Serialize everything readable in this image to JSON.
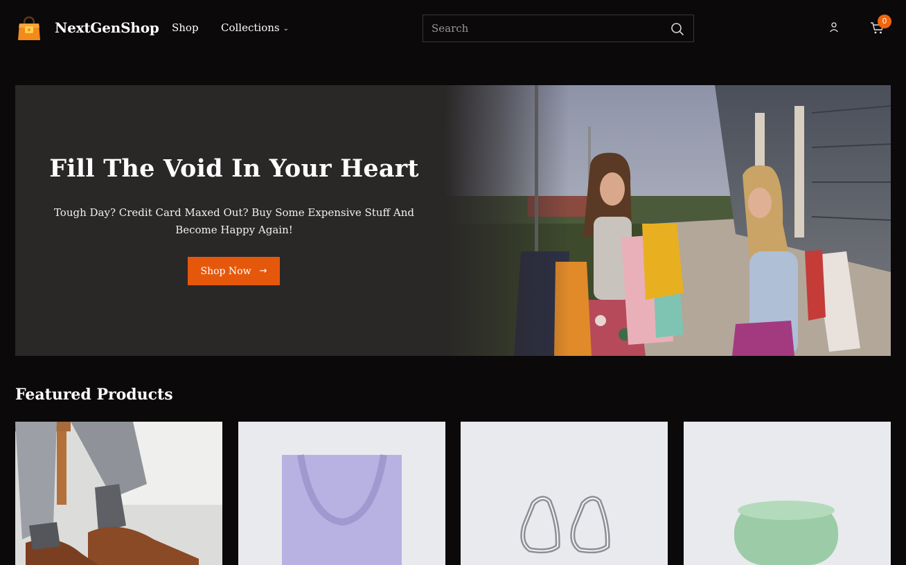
{
  "header": {
    "brand": "NextGenShop",
    "nav": {
      "shop": "Shop",
      "collections": "Collections"
    },
    "search": {
      "placeholder": "Search"
    },
    "cart_count": "0"
  },
  "hero": {
    "title": "Fill The Void In Your Heart",
    "subtitle": "Tough Day? Credit Card Maxed Out? Buy Some Expensive Stuff And Become Happy Again!",
    "cta_label": "Shop Now",
    "cta_icon": "arrow-right-icon"
  },
  "featured": {
    "title": "Featured Products"
  },
  "colors": {
    "accent": "#e5580c",
    "background": "#0b0909",
    "hero_panel": "#2a2727"
  }
}
